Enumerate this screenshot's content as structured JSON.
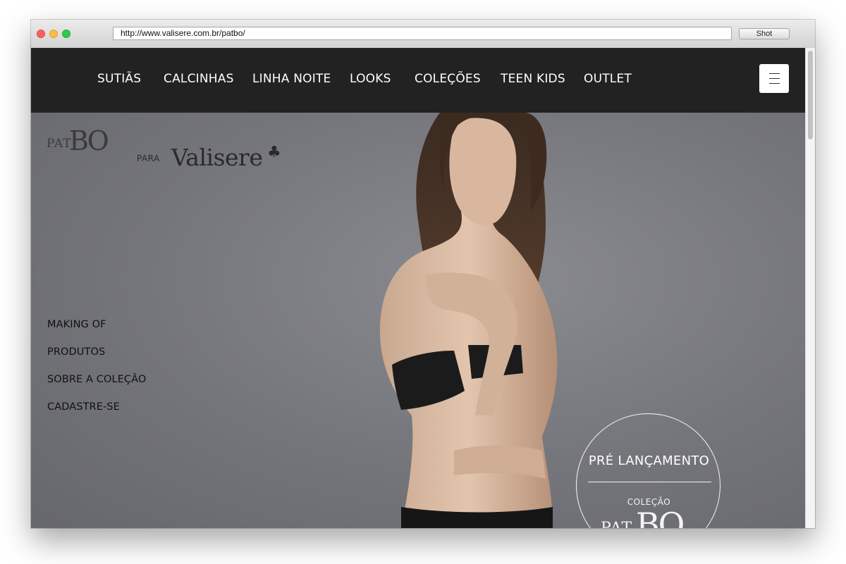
{
  "browser": {
    "url": "http://www.valisere.com.br/patbo/",
    "shot_label": "Shot"
  },
  "nav": {
    "items": [
      {
        "label": "SUTIÃS"
      },
      {
        "label": "CALCINHAS"
      },
      {
        "label": "LINHA NOITE"
      },
      {
        "label": "LOOKS"
      },
      {
        "label": "COLEÇÕES"
      },
      {
        "label": "TEEN KIDS"
      },
      {
        "label": "OUTLET"
      }
    ],
    "menu_icon": "hamburger-icon"
  },
  "brand": {
    "pat": "PAT",
    "bo": "BO",
    "para": "PARA",
    "valisere": "Valisere",
    "club_symbol": "♣"
  },
  "side_menu": {
    "items": [
      {
        "label": "MAKING OF"
      },
      {
        "label": "PRODUTOS"
      },
      {
        "label": "SOBRE A COLEÇÃO"
      },
      {
        "label": "CADASTRE-SE"
      }
    ]
  },
  "badge": {
    "title": "PRÉ LANÇAMENTO",
    "subtitle": "COLEÇÃO",
    "logo_pat": "PAT",
    "logo_bo": "BO"
  },
  "colors": {
    "nav_bg": "#222222",
    "hero_bg": "#76777c",
    "text_dark": "#111111",
    "text_light": "#ffffff"
  }
}
